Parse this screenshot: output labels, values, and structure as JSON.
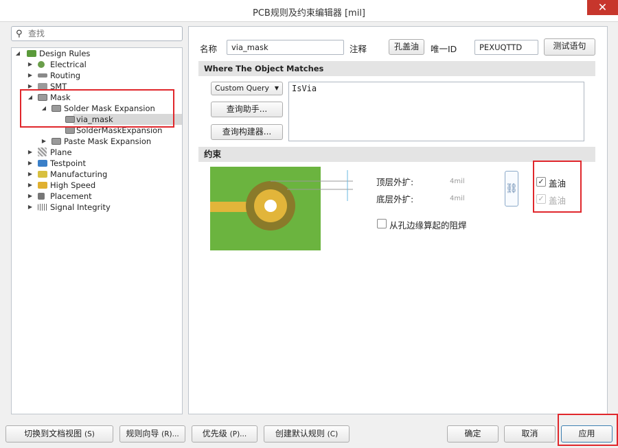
{
  "window": {
    "title": "PCB规则及约束编辑器 [mil]",
    "close": "✕"
  },
  "search": {
    "placeholder": "查找"
  },
  "tree": {
    "root": "Design Rules",
    "items": [
      "Electrical",
      "Routing",
      "SMT",
      "Mask",
      "Solder Mask Expansion",
      "via_mask",
      "SolderMaskExpansion",
      "Paste Mask Expansion",
      "Plane",
      "Testpoint",
      "Manufacturing",
      "High Speed",
      "Placement",
      "Signal Integrity"
    ]
  },
  "rule": {
    "name_label": "名称",
    "name_value": "via_mask",
    "comment_label": "注释",
    "comment_value": "孔盖油",
    "id_label": "唯一ID",
    "id_value": "PEXUQTTD",
    "test_button": "测试语句"
  },
  "match": {
    "header": "Where The Object Matches",
    "query_type": "Custom Query",
    "query_text": "IsVia",
    "helper_button": "查询助手... ",
    "builder_button": "查询构建器... "
  },
  "constraints": {
    "header": "约束",
    "top_label": "顶层外扩:",
    "top_value": "4mil",
    "bottom_label": "底层外扩:",
    "bottom_value": "4mil",
    "from_hole_label": "从孔边缘算起的阻焊",
    "tent_top": "盖油",
    "tent_bottom": "盖油",
    "tent_top_checked": true,
    "tent_bottom_checked": true,
    "tent_bottom_enabled": false
  },
  "footer": {
    "switch_doc": "切换到文档视图",
    "switch_doc_key": "(S)",
    "wizard": "规则向导",
    "wizard_key": "(R)...",
    "priority": "优先级",
    "priority_key": "(P)...",
    "create_default": "创建默认规则",
    "create_default_key": "(C)",
    "ok": "确定",
    "cancel": "取消",
    "apply": "应用"
  },
  "colors": {
    "highlight_red": "#e0262b",
    "board_green": "#6bb43f",
    "copper_ring": "#8a7a2a",
    "copper": "#e2b53a"
  }
}
